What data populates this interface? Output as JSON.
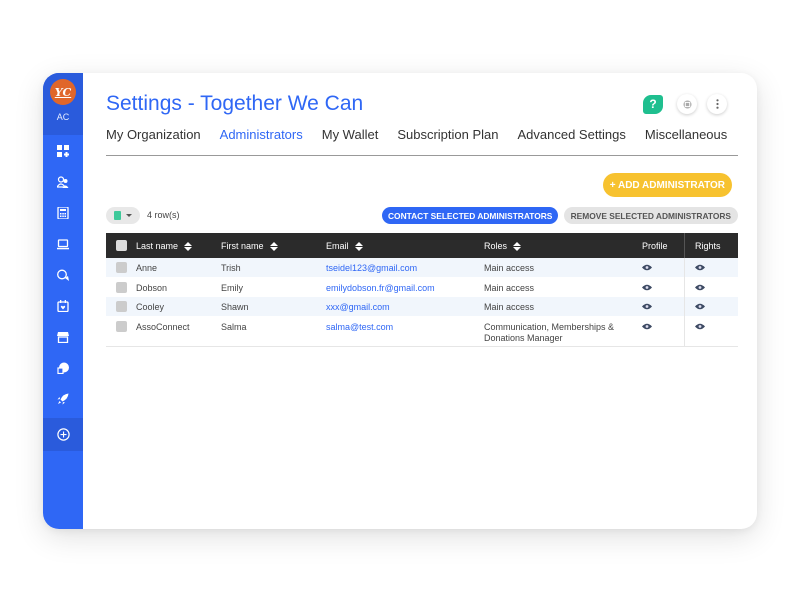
{
  "sidebar": {
    "avatar_text": "YC",
    "user_initials": "AC",
    "items": [
      {
        "name": "dashboard",
        "icon": "dashboard-icon"
      },
      {
        "name": "members",
        "icon": "members-icon"
      },
      {
        "name": "accounting",
        "icon": "calculator-icon"
      },
      {
        "name": "website",
        "icon": "laptop-icon"
      },
      {
        "name": "communication",
        "icon": "chat-icon"
      },
      {
        "name": "events",
        "icon": "calendar-icon"
      },
      {
        "name": "shop",
        "icon": "store-icon"
      },
      {
        "name": "donations",
        "icon": "donation-icon"
      },
      {
        "name": "projects",
        "icon": "rocket-icon"
      }
    ],
    "add_icon": "plus-circle-icon"
  },
  "header": {
    "title": "Settings - Together We Can",
    "help_label": "?",
    "actions": [
      "help-icon",
      "language-icon",
      "more-vertical-icon"
    ]
  },
  "tabs": [
    {
      "label": "My Organization",
      "active": false
    },
    {
      "label": "Administrators",
      "active": true
    },
    {
      "label": "My Wallet",
      "active": false
    },
    {
      "label": "Subscription Plan",
      "active": false
    },
    {
      "label": "Advanced Settings",
      "active": false
    },
    {
      "label": "Miscellaneous",
      "active": false
    }
  ],
  "toolbar": {
    "add_label": "+ ADD ADMINISTRATOR",
    "row_count": "4 row(s)",
    "contact_label": "CONTACT SELECTED ADMINISTRATORS",
    "remove_label": "REMOVE SELECTED ADMINISTRATORS",
    "export_icon": "spreadsheet-icon"
  },
  "table": {
    "columns": [
      "Last name",
      "First name",
      "Email",
      "Roles",
      "Profile",
      "Rights"
    ],
    "rows": [
      {
        "last": "Anne",
        "first": "Trish",
        "email": "tseidel123@gmail.com",
        "roles": "Main access"
      },
      {
        "last": "Dobson",
        "first": "Emily",
        "email": "emilydobson.fr@gmail.com",
        "roles": "Main access"
      },
      {
        "last": "Cooley",
        "first": "Shawn",
        "email": "xxx@gmail.com",
        "roles": "Main access"
      },
      {
        "last": "AssoConnect",
        "first": "Salma",
        "email": "salma@test.com",
        "roles": "Communication, Memberships & Donations Manager"
      }
    ]
  },
  "colors": {
    "primary": "#2f67f5",
    "accent_yellow": "#f7c22f",
    "help_green": "#1fbf8f",
    "avatar_orange": "#e0662a",
    "table_header": "#2b2b2b"
  }
}
